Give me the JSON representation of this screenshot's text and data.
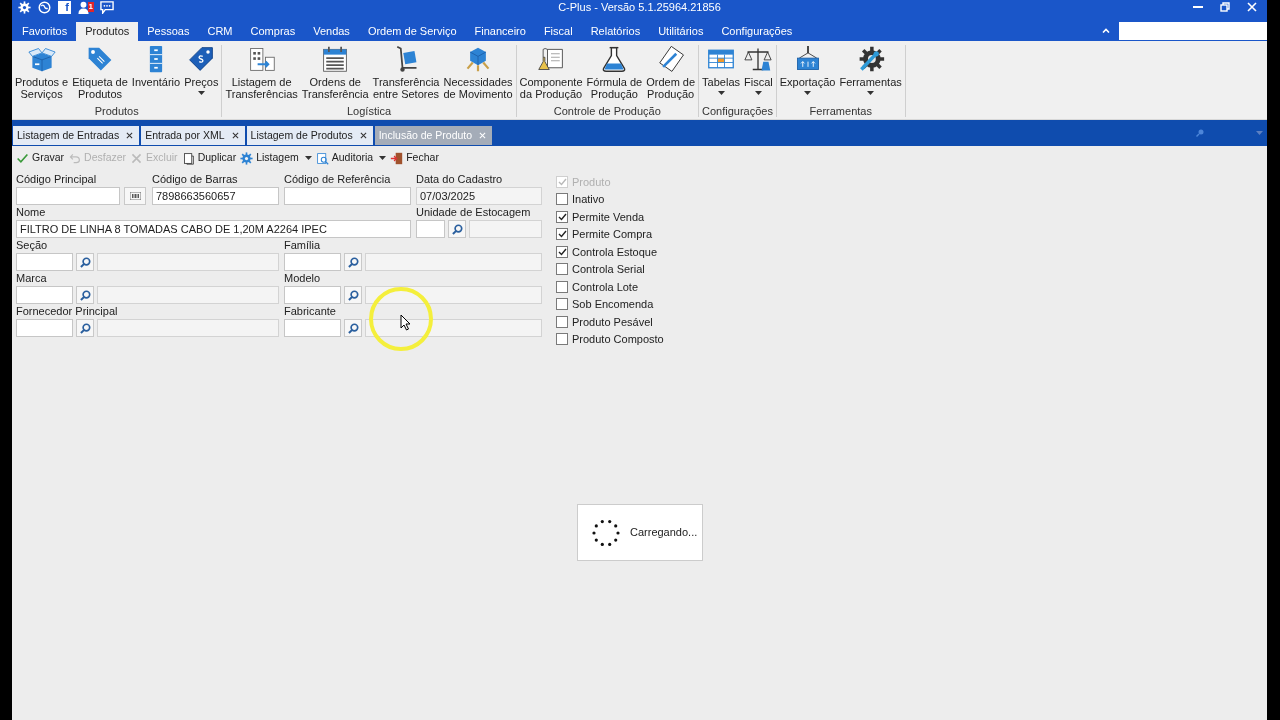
{
  "title_bar": {
    "title": "C-Plus - Versão 5.1.25964.21856",
    "quick_access": [
      {
        "kind": "gear"
      },
      {
        "kind": "globe"
      },
      {
        "kind": "social",
        "letter": "f"
      },
      {
        "kind": "user",
        "badge": "1"
      },
      {
        "kind": "chat"
      }
    ]
  },
  "menu_tabs": [
    {
      "label": "Favoritos",
      "selected": false
    },
    {
      "label": "Produtos",
      "selected": true
    },
    {
      "label": "Pessoas",
      "selected": false
    },
    {
      "label": "CRM",
      "selected": false
    },
    {
      "label": "Compras",
      "selected": false
    },
    {
      "label": "Vendas",
      "selected": false
    },
    {
      "label": "Ordem de Serviço",
      "selected": false
    },
    {
      "label": "Financeiro",
      "selected": false
    },
    {
      "label": "Fiscal",
      "selected": false
    },
    {
      "label": "Relatórios",
      "selected": false
    },
    {
      "label": "Utilitários",
      "selected": false
    },
    {
      "label": "Configurações",
      "selected": false
    }
  ],
  "ribbon": {
    "groups": [
      {
        "label": "Produtos",
        "items": [
          {
            "label": "Produtos e\nServiços",
            "dropdown": false
          },
          {
            "label": "Etiqueta de\nProdutos",
            "dropdown": false
          },
          {
            "label": "Inventário",
            "dropdown": false
          },
          {
            "label": "Preços",
            "dropdown": true
          }
        ]
      },
      {
        "label": "Logística",
        "items": [
          {
            "label": "Listagem de\nTransferências",
            "dropdown": false
          },
          {
            "label": "Ordens de\nTransferência",
            "dropdown": false
          },
          {
            "label": "Transferência\nentre Setores",
            "dropdown": false
          },
          {
            "label": "Necessidades\nde Movimento",
            "dropdown": false
          }
        ]
      },
      {
        "label": "Controle de Produção",
        "items": [
          {
            "label": "Componente\nda Produção",
            "dropdown": false
          },
          {
            "label": "Fórmula de\nProdução",
            "dropdown": false
          },
          {
            "label": "Ordem de\nProdução",
            "dropdown": false
          }
        ]
      },
      {
        "label": "Configurações",
        "items": [
          {
            "label": "Tabelas",
            "dropdown": true
          },
          {
            "label": "Fiscal",
            "dropdown": true
          }
        ]
      },
      {
        "label": "Ferramentas",
        "items": [
          {
            "label": "Exportação",
            "dropdown": true
          },
          {
            "label": "Ferramentas",
            "dropdown": true
          }
        ]
      }
    ]
  },
  "document_tabs": [
    {
      "label": "Listagem de Entradas",
      "selected": false
    },
    {
      "label": "Entrada por XML",
      "selected": false
    },
    {
      "label": "Listagem de Produtos",
      "selected": false
    },
    {
      "label": "Inclusão de Produto",
      "selected": true
    }
  ],
  "toolbar": [
    {
      "label": "Gravar",
      "disabled": false,
      "dropdown": false
    },
    {
      "label": "Desfazer",
      "disabled": true,
      "dropdown": false
    },
    {
      "label": "Excluir",
      "disabled": true,
      "dropdown": false
    },
    {
      "label": "Duplicar",
      "disabled": false,
      "dropdown": false
    },
    {
      "label": "Listagem",
      "disabled": false,
      "dropdown": true
    },
    {
      "label": "Auditoria",
      "disabled": false,
      "dropdown": true
    },
    {
      "label": "Fechar",
      "disabled": false,
      "dropdown": false
    }
  ],
  "form": {
    "fields": [
      {
        "kind": "barcode_code",
        "label": "Código Principal"
      },
      {
        "kind": "text",
        "label": "Código de Barras",
        "value": "7898663560657",
        "readonly": false
      },
      {
        "kind": "text",
        "label": "Código de Referência",
        "readonly": false
      },
      {
        "kind": "text",
        "label": "Data do Cadastro",
        "value": "07/03/2025",
        "readonly": true
      },
      {
        "kind": "long_text",
        "label": "Nome",
        "value": "FILTRO DE LINHA 8 TOMADAS CABO DE 1,20M A2264 IPEC",
        "readonly": false
      },
      {
        "kind": "short_lookup",
        "label": "Unidade de Estocagem"
      },
      {
        "kind": "lookup",
        "label": "Seção"
      },
      {
        "kind": "lookup",
        "label": "Família"
      },
      {
        "kind": "lookup",
        "label": "Marca"
      },
      {
        "kind": "lookup",
        "label": "Modelo"
      },
      {
        "kind": "lookup",
        "label": "Fornecedor Principal"
      },
      {
        "kind": "lookup",
        "label": "Fabricante"
      }
    ]
  },
  "flags": [
    {
      "label": "Produto",
      "checked": true,
      "disabled": true
    },
    {
      "label": "Inativo",
      "checked": false,
      "disabled": false
    },
    {
      "label": "Permite Venda",
      "checked": true,
      "disabled": false
    },
    {
      "label": "Permite Compra",
      "checked": true,
      "disabled": false
    },
    {
      "label": "Controla Estoque",
      "checked": true,
      "disabled": false
    },
    {
      "label": "Controla Serial",
      "checked": false,
      "disabled": false
    },
    {
      "label": "Controla Lote",
      "checked": false,
      "disabled": false
    },
    {
      "label": "Sob Encomenda",
      "checked": false,
      "disabled": false
    },
    {
      "label": "Produto Pesável",
      "checked": false,
      "disabled": false
    },
    {
      "label": "Produto Composto",
      "checked": false,
      "disabled": false
    }
  ],
  "loading": {
    "text": "Carregando..."
  }
}
